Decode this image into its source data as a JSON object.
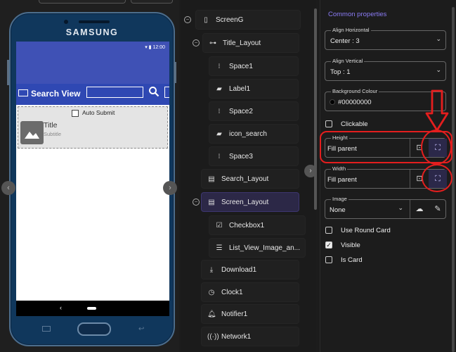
{
  "phone": {
    "brand": "SAMSUNG",
    "status_time": "12:00",
    "search_title": "Search View",
    "checkbox_label": "Auto Submit",
    "item_title": "Title",
    "item_subtitle": "Subtitle",
    "nav_back": "‹"
  },
  "tree": {
    "nodes": [
      {
        "label": "ScreenG",
        "icon": "phone-icon"
      },
      {
        "label": "Title_Layout",
        "icon": "horizontal-layout-icon"
      },
      {
        "label": "Space1",
        "icon": "space-icon"
      },
      {
        "label": "Label1",
        "icon": "label-icon"
      },
      {
        "label": "Space2",
        "icon": "space-icon"
      },
      {
        "label": "icon_search",
        "icon": "image-icon"
      },
      {
        "label": "Space3",
        "icon": "space-icon"
      },
      {
        "label": "Search_Layout",
        "icon": "vertical-layout-icon"
      },
      {
        "label": "Screen_Layout",
        "icon": "vertical-layout-icon"
      },
      {
        "label": "Checkbox1",
        "icon": "checkbox-icon"
      },
      {
        "label": "List_View_Image_an...",
        "icon": "list-icon"
      },
      {
        "label": "Download1",
        "icon": "download-icon"
      },
      {
        "label": "Clock1",
        "icon": "clock-icon"
      },
      {
        "label": "Notifier1",
        "icon": "bell-icon"
      },
      {
        "label": "Network1",
        "icon": "network-icon"
      }
    ]
  },
  "props": {
    "title": "Common properties",
    "align_h": {
      "label": "Align Horizontal",
      "value": "Center : 3"
    },
    "align_v": {
      "label": "Align Vertical",
      "value": "Top : 1"
    },
    "bg_colour": {
      "label": "Background Colour",
      "value": "#00000000"
    },
    "clickable": {
      "label": "Clickable",
      "checked": false
    },
    "height": {
      "label": "Height",
      "value": "Fill parent"
    },
    "width": {
      "label": "Width",
      "value": "Fill parent"
    },
    "image": {
      "label": "Image",
      "value": "None"
    },
    "use_round_card": {
      "label": "Use Round Card",
      "checked": false
    },
    "visible": {
      "label": "Visible",
      "checked": true
    },
    "is_card": {
      "label": "Is Card",
      "checked": false
    }
  },
  "colors": {
    "accent": "#8b7cf6",
    "app_bar": "#3f51b5",
    "annotation": "#e41e1e",
    "selected_node": "#2c2847"
  }
}
